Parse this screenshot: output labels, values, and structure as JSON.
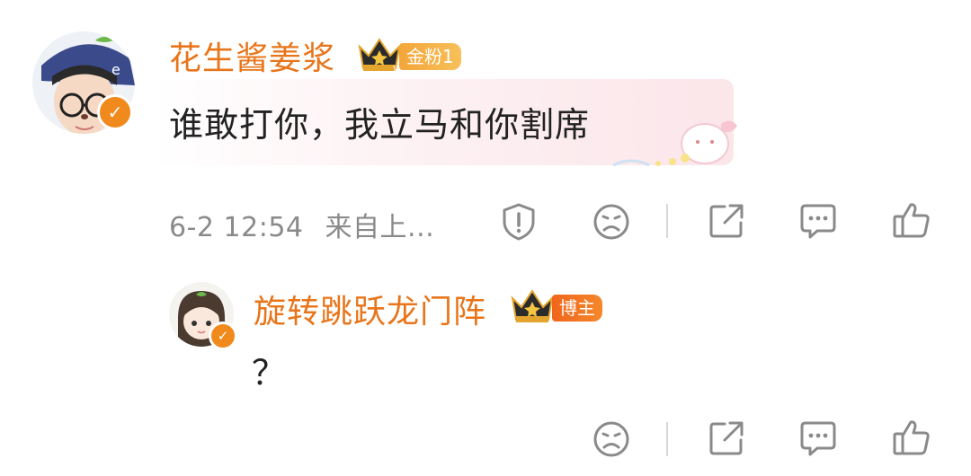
{
  "comment": {
    "username": "花生酱姜浆",
    "badge_label": "金粉1",
    "text": "谁敢打你，我立马和你割席",
    "timestamp": "6-2 12:54",
    "source": "来自上..."
  },
  "reply": {
    "username": "旋转跳跃龙门阵",
    "badge_label": "博主",
    "text": "？"
  },
  "colors": {
    "username": "#e8751a",
    "icon": "#8a8a8a",
    "verified": "#f08a1c"
  },
  "icons": [
    "report-icon",
    "dislike-face-icon",
    "share-icon",
    "comment-icon",
    "like-icon",
    "crown-icon",
    "verified-icon"
  ]
}
